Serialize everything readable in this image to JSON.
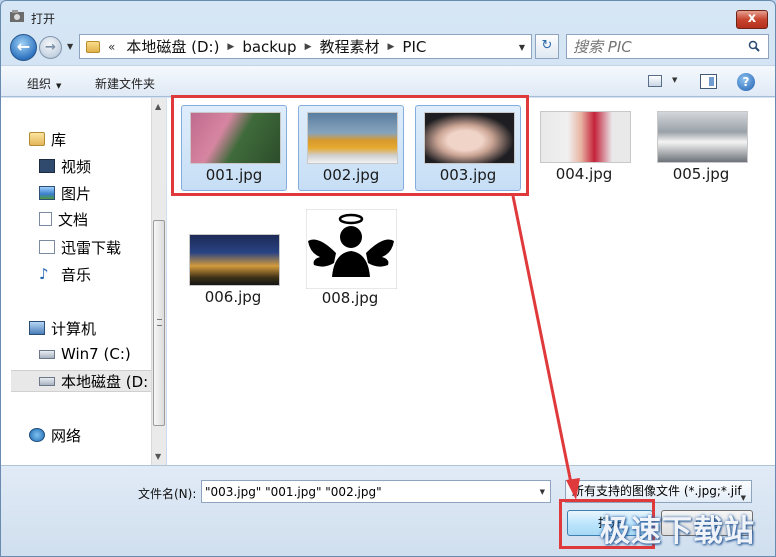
{
  "window": {
    "title": "打开",
    "close_label": "x"
  },
  "nav": {
    "back_label": "←",
    "forward_label": "→",
    "address": [
      "本地磁盘 (D:)",
      "backup",
      "教程素材",
      "PIC"
    ],
    "overflow_label": "«",
    "refresh_label": "↻",
    "search_placeholder": "搜索 PIC"
  },
  "commandbar": {
    "organize": "组织",
    "new_folder": "新建文件夹",
    "help_label": "?"
  },
  "sidebar": {
    "items": [
      {
        "label": "库",
        "icon": "library-icon"
      },
      {
        "label": "视频",
        "icon": "video-icon"
      },
      {
        "label": "图片",
        "icon": "pictures-icon"
      },
      {
        "label": "文档",
        "icon": "documents-icon"
      },
      {
        "label": "迅雷下载",
        "icon": "download-icon"
      },
      {
        "label": "音乐",
        "icon": "music-icon"
      },
      {
        "label": "计算机",
        "icon": "computer-icon"
      },
      {
        "label": "Win7 (C:)",
        "icon": "drive-icon"
      },
      {
        "label": "本地磁盘 (D:",
        "icon": "drive-icon"
      },
      {
        "label": "网络",
        "icon": "network-icon"
      }
    ]
  },
  "files": [
    {
      "name": "001.jpg",
      "selected": true
    },
    {
      "name": "002.jpg",
      "selected": true
    },
    {
      "name": "003.jpg",
      "selected": true
    },
    {
      "name": "004.jpg",
      "selected": false
    },
    {
      "name": "005.jpg",
      "selected": false
    },
    {
      "name": "006.jpg",
      "selected": false
    },
    {
      "name": "008.jpg",
      "selected": false
    }
  ],
  "bottom": {
    "filename_label": "文件名(N):",
    "filename_value": "\"003.jpg\" \"001.jpg\" \"002.jpg\"",
    "filetype_value": "所有支持的图像文件 (*.jpg;*.jif",
    "open_label": "打开",
    "cancel_label": "取消"
  },
  "watermark": "极速下载站",
  "colors": {
    "annotation": "#e0393b",
    "selection": "#c6def5"
  }
}
